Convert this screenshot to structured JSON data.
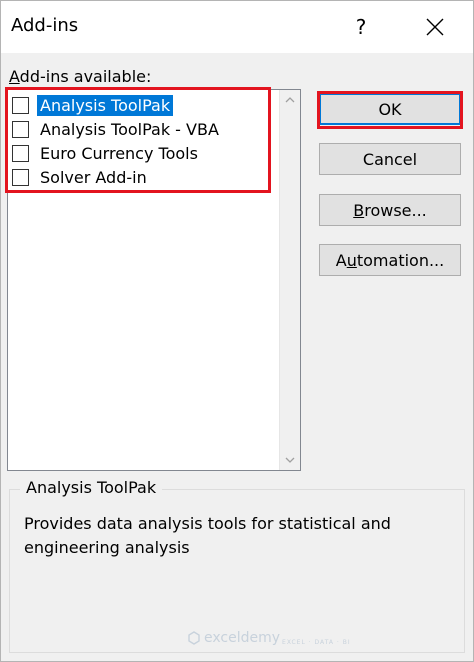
{
  "window": {
    "title": "Add-ins",
    "help_label": "?"
  },
  "list": {
    "label_prefix": "A",
    "label_rest": "dd-ins available:",
    "items": [
      {
        "label": "Analysis ToolPak",
        "checked": false,
        "selected": true
      },
      {
        "label": "Analysis ToolPak - VBA",
        "checked": false,
        "selected": false
      },
      {
        "label": "Euro Currency Tools",
        "checked": false,
        "selected": false
      },
      {
        "label": "Solver Add-in",
        "checked": false,
        "selected": false
      }
    ]
  },
  "buttons": {
    "ok": "OK",
    "cancel": "Cancel",
    "browse_prefix": "B",
    "browse_rest": "rowse...",
    "automation_pre": "A",
    "automation_ul": "u",
    "automation_rest": "tomation..."
  },
  "description": {
    "title": "Analysis ToolPak",
    "text": "Provides data analysis tools for statistical and engineering analysis"
  },
  "watermark": {
    "brand": "exceldemy",
    "tagline": "EXCEL · DATA · BI"
  },
  "colors": {
    "highlight": "#e3141f",
    "selection": "#0078d7"
  }
}
